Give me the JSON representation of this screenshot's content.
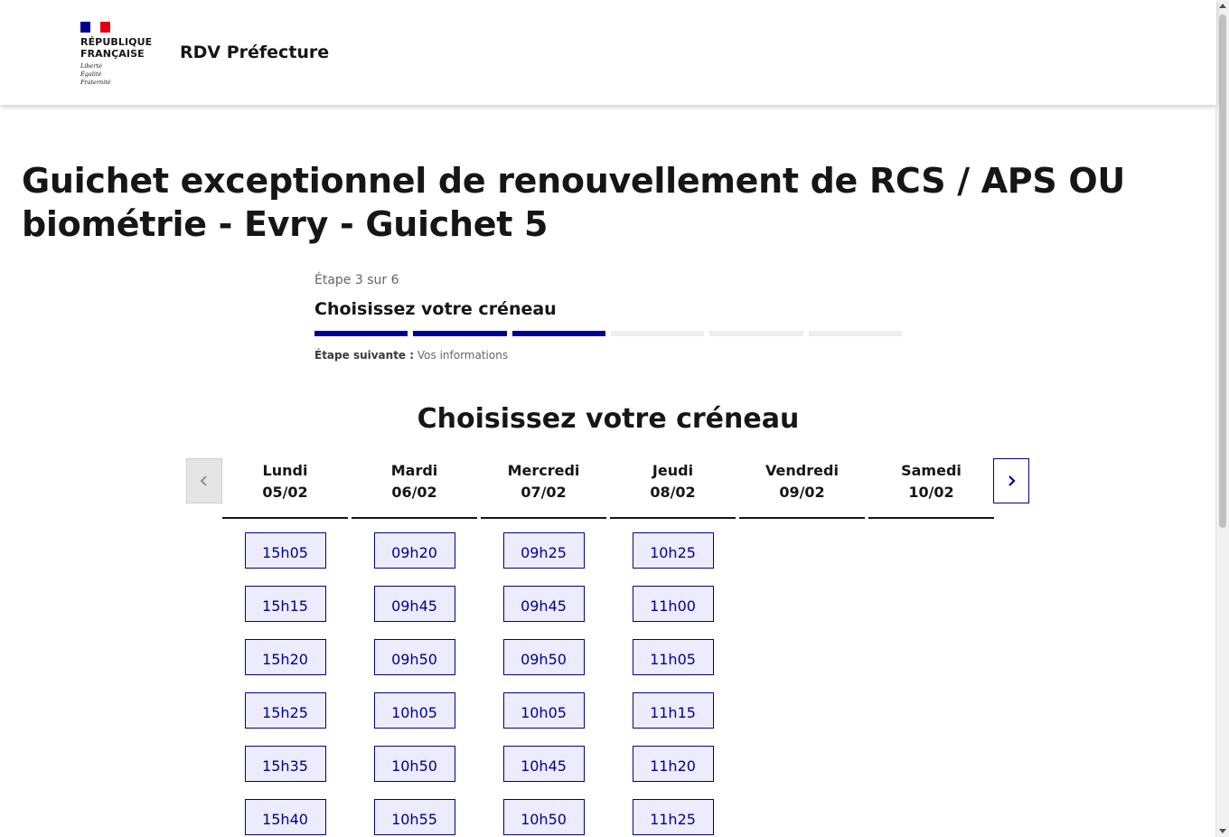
{
  "header": {
    "republic_line1": "RÉPUBLIQUE",
    "republic_line2": "FRANÇAISE",
    "motto": [
      "Liberté",
      "Égalité",
      "Fraternité"
    ],
    "service_title": "RDV Préfecture",
    "flag_colors": [
      "#000091",
      "#ffffff",
      "#e1000f"
    ]
  },
  "page": {
    "title": "Guichet exceptionnel de renouvellement de RCS / APS OU biométrie - Evry - Guichet 5"
  },
  "stepper": {
    "state": "Étape 3 sur 6",
    "title": "Choisissez votre créneau",
    "current_step": 3,
    "total_steps": 6,
    "next_label": "Étape suivante :",
    "next_value": "Vos informations"
  },
  "slots": {
    "title": "Choisissez votre créneau",
    "prev_icon": "chevron-left-icon",
    "next_icon": "chevron-right-icon",
    "days": [
      {
        "name": "Lundi",
        "date": "05/02",
        "times": [
          "15h05",
          "15h15",
          "15h20",
          "15h25",
          "15h35",
          "15h40"
        ]
      },
      {
        "name": "Mardi",
        "date": "06/02",
        "times": [
          "09h20",
          "09h45",
          "09h50",
          "10h05",
          "10h50",
          "10h55"
        ]
      },
      {
        "name": "Mercredi",
        "date": "07/02",
        "times": [
          "09h25",
          "09h45",
          "09h50",
          "10h05",
          "10h45",
          "10h50"
        ]
      },
      {
        "name": "Jeudi",
        "date": "08/02",
        "times": [
          "10h25",
          "11h00",
          "11h05",
          "11h15",
          "11h20",
          "11h25"
        ]
      },
      {
        "name": "Vendredi",
        "date": "09/02",
        "times": []
      },
      {
        "name": "Samedi",
        "date": "10/02",
        "times": []
      }
    ]
  },
  "colors": {
    "accent": "#000091",
    "slot_background": "#ececfe",
    "step_inactive": "#eeeeee"
  }
}
